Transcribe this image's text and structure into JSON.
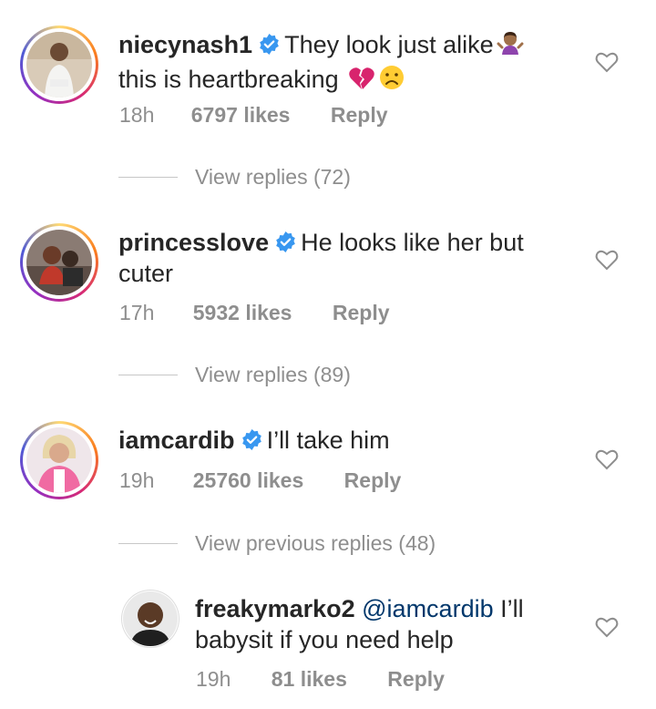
{
  "comments": [
    {
      "username": "niecynash1",
      "verified": true,
      "text_line1": "They look just alike",
      "text_line2": "this is heartbreaking",
      "emojis": [
        "shrug-emoji",
        "broken-heart-emoji",
        "frowning-face-emoji"
      ],
      "time": "18h",
      "likes": "6797 likes",
      "reply": "Reply",
      "view_replies": "View replies (72)"
    },
    {
      "username": "princesslove",
      "verified": true,
      "text_line1": "He looks like her but",
      "text_line2": "cuter",
      "time": "17h",
      "likes": "5932 likes",
      "reply": "Reply",
      "view_replies": "View replies (89)"
    },
    {
      "username": "iamcardib",
      "verified": true,
      "text_line1": "I’ll take him",
      "time": "19h",
      "likes": "25760 likes",
      "reply": "Reply",
      "view_replies": "View previous replies (48)"
    }
  ],
  "reply_comment": {
    "username": "freakymarko2",
    "mention": "@iamcardib",
    "text_line1": "I’ll",
    "text_line2": "babysit if you need help",
    "time": "19h",
    "likes": "81 likes",
    "reply": "Reply"
  },
  "colors": {
    "text": "#262626",
    "secondary": "#8e8e8e",
    "verified_blue": "#3897f0",
    "mention": "#00376b"
  },
  "icons": {
    "like": "heart-outline-icon",
    "verified": "verified-badge-icon"
  }
}
